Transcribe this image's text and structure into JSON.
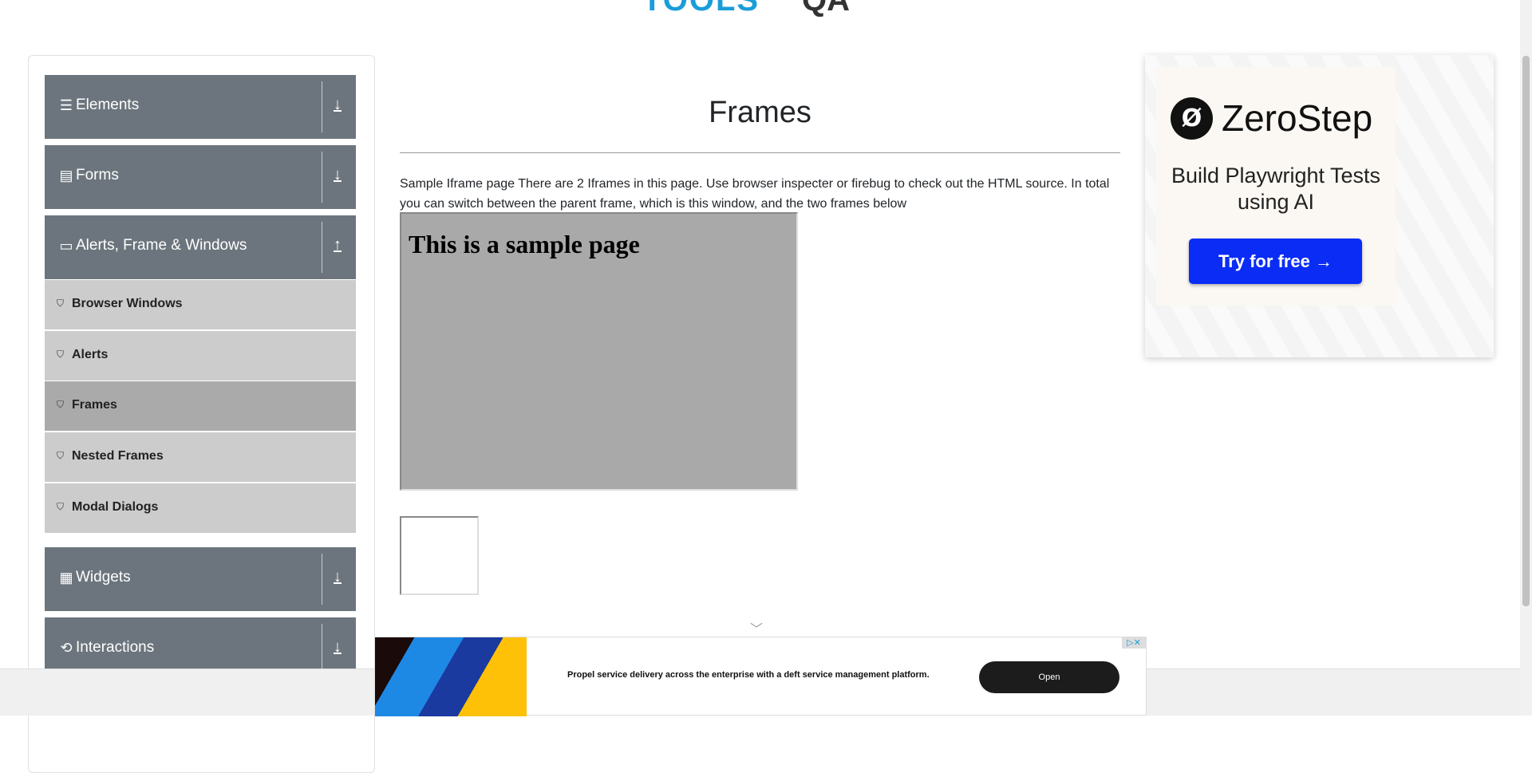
{
  "logo": {
    "tools": "TOOLS",
    "qa": "QA"
  },
  "sidebar": {
    "groups": [
      {
        "label": "Elements",
        "icon": "☰",
        "arrow": "↓"
      },
      {
        "label": "Forms",
        "icon": "▤",
        "arrow": "↓"
      },
      {
        "label": "Alerts, Frame & Windows",
        "icon": "▭",
        "arrow": "↑"
      },
      {
        "label": "Widgets",
        "icon": "▦",
        "arrow": "↓"
      },
      {
        "label": "Interactions",
        "icon": "⟲",
        "arrow": "↓"
      }
    ],
    "items": [
      {
        "label": "Browser Windows"
      },
      {
        "label": "Alerts"
      },
      {
        "label": "Frames",
        "active": true
      },
      {
        "label": "Nested Frames"
      },
      {
        "label": "Modal Dialogs"
      }
    ]
  },
  "main": {
    "title": "Frames",
    "description": "Sample Iframe page There are 2 Iframes in this page. Use browser inspecter or firebug to check out the HTML source. In total you can switch between the parent frame, which is this window, and the two frames below",
    "frame1_heading": "This is a sample page"
  },
  "side_ad": {
    "brand": "ZeroStep",
    "tagline": "Build Playwright Tests using AI",
    "button": "Try for free →"
  },
  "bottom_ad": {
    "text": "Propel service delivery across the enterprise with a deft service management platform.",
    "button": "Open",
    "close": "▷✕"
  },
  "colors": {
    "sidebar_header": "#6c757d",
    "submenu": "#cccccc",
    "submenu_active": "#aaaaaa",
    "ad_button": "#0a2cf5"
  }
}
